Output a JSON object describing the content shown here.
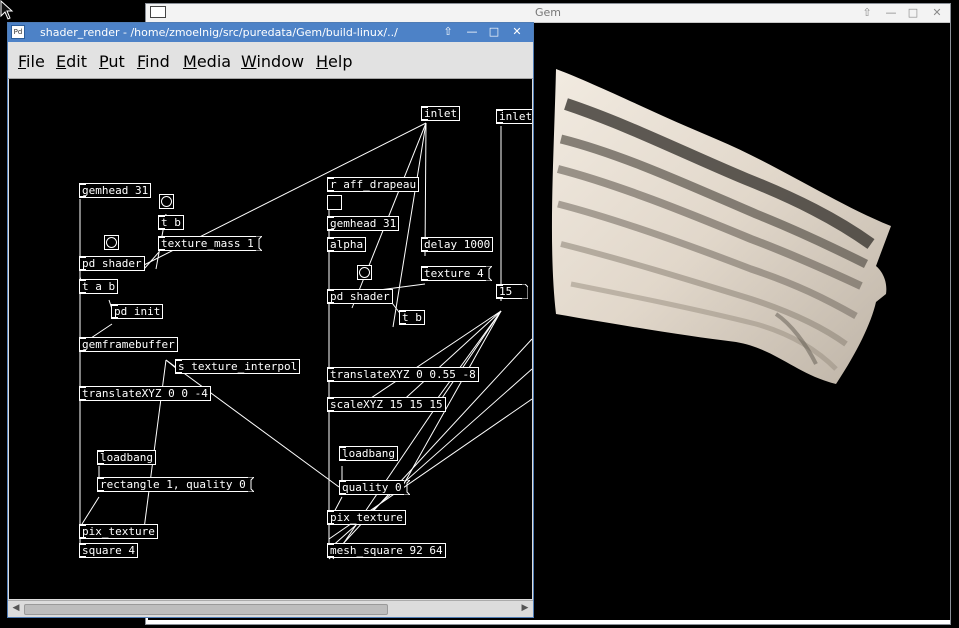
{
  "gem": {
    "title": "Gem",
    "buttons": {
      "up": "⇧",
      "minimize": "—",
      "maximize": "□",
      "close": "✕"
    }
  },
  "pd": {
    "title": "shader_render - /home/zmoelnig/src/puredata/Gem/build-linux/../",
    "buttons": {
      "up": "⇧",
      "minimize": "—",
      "maximize": "□",
      "close": "✕"
    },
    "appicon": "Pd",
    "menu": [
      "File",
      "Edit",
      "Put",
      "Find",
      "Media",
      "Window",
      "Help"
    ],
    "objects": {
      "gemhead31a": "gemhead 31",
      "tb1": "t b",
      "texture_mass": "texture_mass 1",
      "pd_shader1": "pd shader",
      "tab": "t a b",
      "pd_init": "pd init",
      "gemframebuffer": "gemframebuffer",
      "s_texture_interpol": "s texture_interpol",
      "translate1": "translateXYZ 0 0 -4",
      "loadbang1": "loadbang",
      "rectangle": "rectangle 1, quality 0",
      "pix_texture1": "pix_texture",
      "square": "square 4",
      "r_aff": "r aff_drapeau",
      "gemhead31b": "gemhead 31",
      "alpha": "alpha",
      "pd_shader2": "pd shader",
      "tb2": "t b",
      "inlet1": "inlet",
      "delay": "delay 1000",
      "texture4": "texture 4",
      "inlet2": "inlet",
      "num15": "15",
      "translate2": "translateXYZ 0 0.55 -8",
      "scale": "scaleXYZ 15 15 15",
      "loadbang2": "loadbang",
      "quality": "quality 0",
      "pix_texture2": "pix_texture",
      "mesh": "mesh_square 92 64"
    }
  },
  "colors": {
    "pd_titlebar": "#4d82c7",
    "canvas": "#000000",
    "flag": "#e8dfd4"
  }
}
